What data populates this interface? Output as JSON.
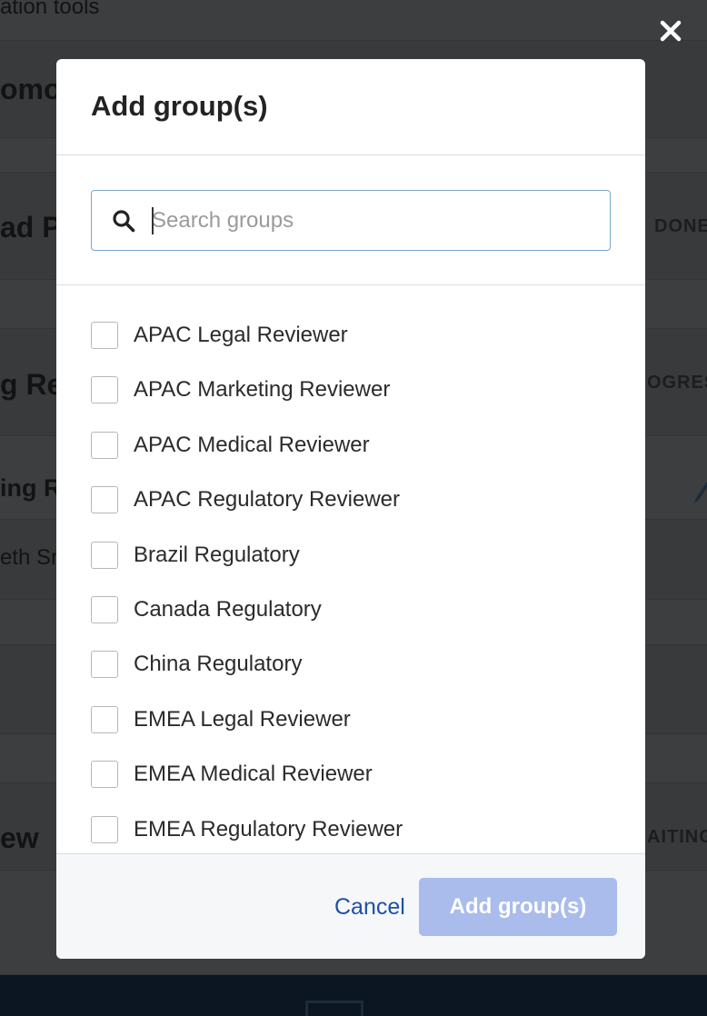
{
  "background": {
    "texts": {
      "t1": "ation tools",
      "t2": "omot",
      "t3": "ad Pr",
      "t4": "DONE",
      "t5": "g Rev",
      "t6": "OGRESS",
      "t7": "ing Re",
      "t8": "eth Sm",
      "t9": "ew",
      "t10": "AITING"
    }
  },
  "modal": {
    "title": "Add group(s)",
    "search": {
      "placeholder": "Search groups",
      "value": ""
    },
    "groups": [
      {
        "label": "APAC Legal Reviewer",
        "checked": false
      },
      {
        "label": "APAC Marketing Reviewer",
        "checked": false
      },
      {
        "label": "APAC Medical Reviewer",
        "checked": false
      },
      {
        "label": "APAC Regulatory Reviewer",
        "checked": false
      },
      {
        "label": "Brazil Regulatory",
        "checked": false
      },
      {
        "label": "Canada Regulatory",
        "checked": false
      },
      {
        "label": "China Regulatory",
        "checked": false
      },
      {
        "label": "EMEA Legal Reviewer",
        "checked": false
      },
      {
        "label": "EMEA Medical Reviewer",
        "checked": false
      },
      {
        "label": "EMEA Regulatory Reviewer",
        "checked": false
      }
    ],
    "footer": {
      "cancel_label": "Cancel",
      "add_label": "Add group(s)"
    }
  },
  "colors": {
    "overlay": "#3c3d3e",
    "accent_link": "#1f4fa8",
    "add_button_disabled": "#a9bcec",
    "search_border": "#7aa8c9"
  },
  "icons": [
    "close-icon",
    "search-icon",
    "pencil-icon"
  ]
}
